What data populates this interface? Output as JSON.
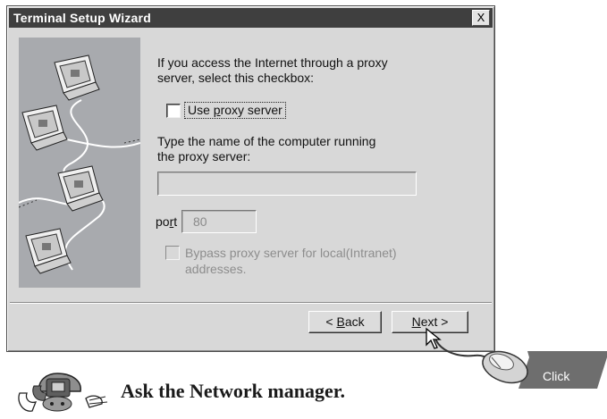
{
  "window": {
    "title": "Terminal Setup Wizard",
    "close_label": "X"
  },
  "proxy": {
    "intro_line1": "If you access the Internet through a proxy",
    "intro_line2": "server, select this checkbox:",
    "use_proxy_pre": "Use ",
    "use_proxy_access": "p",
    "use_proxy_post": "roxy server",
    "use_proxy_checked": false,
    "name_prompt_line1": "Type the name of the computer running",
    "name_prompt_line2": "the proxy server:",
    "name_value": "",
    "port_label_pre": "po",
    "port_label_access": "r",
    "port_label_post": "t",
    "port_value": "80",
    "bypass_line1": "Bypass proxy server for local(Intranet)",
    "bypass_line2": "addresses.",
    "bypass_checked": false
  },
  "buttons": {
    "back_pre": "< ",
    "back_access": "B",
    "back_post": "ack",
    "next_access": "N",
    "next_post": "ext >"
  },
  "annotation": {
    "click_label": "Click",
    "footer_text": "Ask the Network manager."
  },
  "colors": {
    "titlebar": "#3f3f3f",
    "dialog_bg": "#d8d8d8",
    "disabled_text": "#8d8d8d",
    "click_tag_bg": "#6e6e6e"
  },
  "icons": [
    "computer-icon",
    "mouse-icon",
    "pointer-arrow-icon",
    "telephone-icon",
    "hand-icon"
  ]
}
